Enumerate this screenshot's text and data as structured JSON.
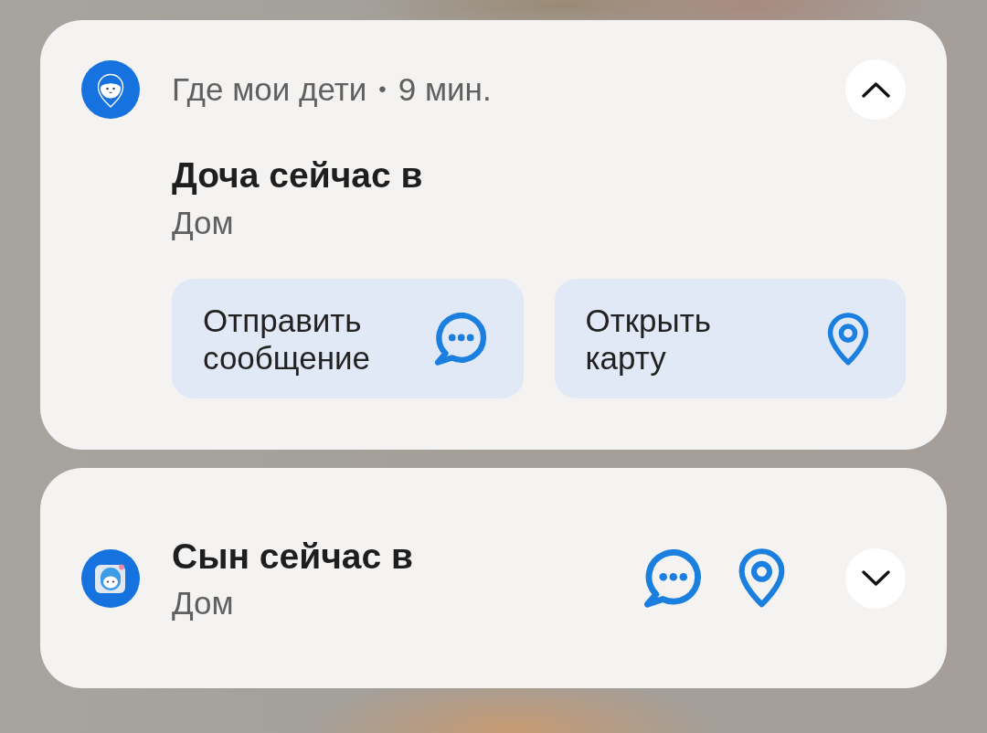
{
  "notifications": [
    {
      "app_name": "Где мои дети",
      "separator": "•",
      "time": "9 мин.",
      "title": "Доча сейчас в",
      "text": "Дом",
      "expanded": true,
      "actions": [
        {
          "kind": "message",
          "label": "Отправить сообщение"
        },
        {
          "kind": "map",
          "label": "Открыть карту"
        }
      ]
    },
    {
      "title": "Сын сейчас в",
      "text": "Дом",
      "expanded": false,
      "actions": [
        {
          "kind": "message"
        },
        {
          "kind": "map"
        }
      ]
    }
  ]
}
